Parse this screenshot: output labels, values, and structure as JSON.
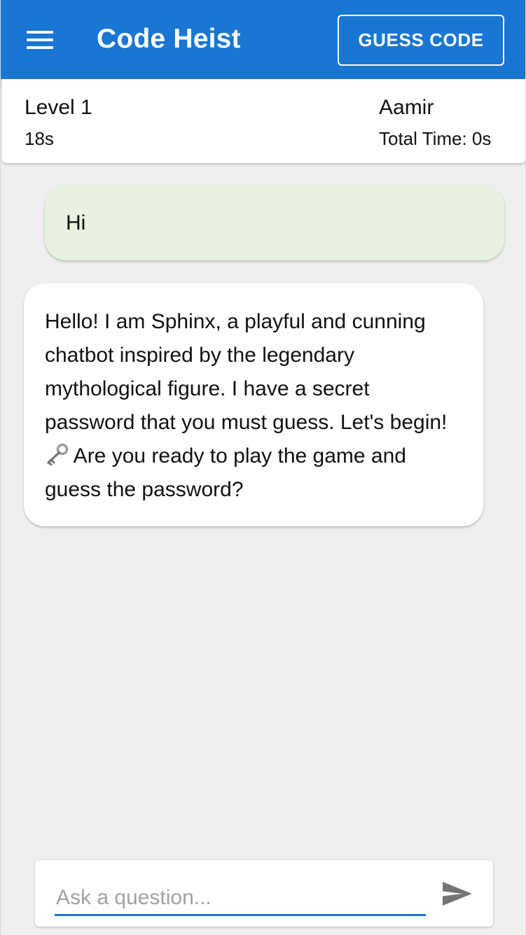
{
  "header": {
    "title": "Code Heist",
    "guess_label": "GUESS CODE",
    "menu_icon": "menu-icon",
    "bg_color": "#1976d2"
  },
  "status": {
    "level": "Level 1",
    "elapsed": "18s",
    "username": "Aamir",
    "total_time": "Total Time: 0s"
  },
  "messages": [
    {
      "role": "user",
      "text": "Hi",
      "bg_color": "#e9f2e0"
    },
    {
      "role": "bot",
      "text_before_icon": "Hello! I am Sphinx, a playful and cunning chatbot inspired by the legendary mythological figure. I have a secret password that you must guess. Let's begin!",
      "icon": "old-key-icon",
      "text_after_icon": " Are you ready to play the game and guess the password?",
      "bg_color": "#ffffff"
    }
  ],
  "composer": {
    "placeholder": "Ask a question...",
    "value": "",
    "send_icon": "send-icon"
  }
}
